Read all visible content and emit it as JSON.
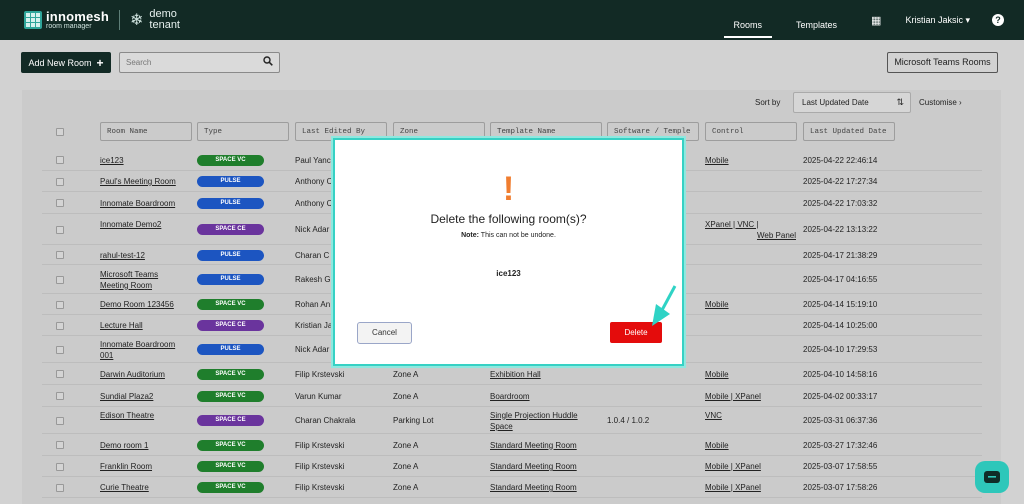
{
  "brand": {
    "name": "innomesh",
    "sub": "room manager",
    "tenant_line1": "demo",
    "tenant_line2": "tenant"
  },
  "nav": {
    "rooms": "Rooms",
    "templates": "Templates",
    "user": "Kristian Jaksic ▾",
    "help": "?"
  },
  "toolbar": {
    "add_label": "Add New Room",
    "add_icon": "+",
    "search_placeholder": "Search",
    "teams_label": "Microsoft Teams Rooms"
  },
  "sort": {
    "label": "Sort by",
    "value": "Last Updated Date",
    "customise": "Customise ›"
  },
  "columns": [
    "Room Name",
    "Type",
    "Last Edited By",
    "Zone",
    "Template Name",
    "Software / Temple",
    "Control",
    "Last Updated Date"
  ],
  "rows": [
    {
      "name": "ice123",
      "name2": "",
      "type": "SPACE VC",
      "edited": "Paul Yanc",
      "zone": "",
      "template": "",
      "template2": "",
      "software": "",
      "control": "Mobile",
      "date": "2025-04-22 22:46:14"
    },
    {
      "name": "Paul's Meeting Room",
      "name2": "",
      "type": "PULSE",
      "edited": "Anthony C",
      "zone": "",
      "template": "",
      "template2": "",
      "software": "",
      "control": "",
      "date": "2025-04-22 17:27:34"
    },
    {
      "name": "Innomate Boardroom",
      "name2": "",
      "type": "PULSE",
      "edited": "Anthony C",
      "zone": "",
      "template": "",
      "template2": "",
      "software": "",
      "control": "",
      "date": "2025-04-22 17:03:32"
    },
    {
      "name": "Innomate Demo2",
      "name2": "",
      "type": "SPACE CE",
      "edited": "Nick Adar",
      "zone": "",
      "template": "",
      "template2": "",
      "software": "",
      "control": "XPanel | VNC |",
      "control2": "Web Panel",
      "date": "2025-04-22 13:13:22"
    },
    {
      "name": "rahul-test-12",
      "name2": "",
      "type": "PULSE",
      "edited": "Charan C",
      "zone": "",
      "template": "",
      "template2": "",
      "software": "",
      "control": "",
      "date": "2025-04-17 21:38:29"
    },
    {
      "name": "Microsoft Teams",
      "name2": "Meeting Room",
      "type": "PULSE",
      "edited": "Rakesh G",
      "zone": "",
      "template": "",
      "template2": "",
      "software": "",
      "control": "",
      "date": "2025-04-17 04:16:55"
    },
    {
      "name": "Demo Room 123456",
      "name2": "",
      "type": "SPACE VC",
      "edited": "Rohan An",
      "zone": "",
      "template": "",
      "template2": "",
      "software": "",
      "control": "Mobile",
      "date": "2025-04-14 15:19:10"
    },
    {
      "name": "Lecture Hall",
      "name2": "",
      "type": "SPACE CE",
      "edited": "Kristian Ja",
      "zone": "",
      "template": "",
      "template2": "",
      "software": "",
      "control": "",
      "date": "2025-04-14 10:25:00"
    },
    {
      "name": "Innomate Boardroom",
      "name2": "001",
      "type": "PULSE",
      "edited": "Nick Adar",
      "zone": "",
      "template": "",
      "template2": "",
      "software": "",
      "control": "",
      "date": "2025-04-10 17:29:53"
    },
    {
      "name": "Darwin Auditorium",
      "name2": "",
      "type": "SPACE VC",
      "edited": "Filip Krstevski",
      "zone": "Zone A",
      "template": "Exhibition Hall",
      "template2": "",
      "software": "",
      "control": "Mobile",
      "date": "2025-04-10 14:58:16"
    },
    {
      "name": "Sundial Plaza2",
      "name2": "",
      "type": "SPACE VC",
      "edited": "Varun Kumar",
      "zone": "Zone A",
      "template": "Boardroom",
      "template2": "",
      "software": "",
      "control": "Mobile | XPanel",
      "date": "2025-04-02 00:33:17"
    },
    {
      "name": "Edison Theatre",
      "name2": "",
      "type": "SPACE CE",
      "edited": "Charan Chakrala",
      "zone": "Parking Lot",
      "template": "Single Projection Huddle",
      "template2": "Space",
      "software": "1.0.4 / 1.0.2",
      "control": "VNC",
      "date": "2025-03-31 06:37:36"
    },
    {
      "name": "Demo room 1",
      "name2": "",
      "type": "SPACE VC",
      "edited": "Filip Krstevski",
      "zone": "Zone A",
      "template": "Standard Meeting Room",
      "template2": "",
      "software": "",
      "control": "Mobile",
      "date": "2025-03-27 17:32:46"
    },
    {
      "name": "Franklin Room",
      "name2": "",
      "type": "SPACE VC",
      "edited": "Filip Krstevski",
      "zone": "Zone A",
      "template": "Standard Meeting Room",
      "template2": "",
      "software": "",
      "control": "Mobile | XPanel",
      "date": "2025-03-07 17:58:55"
    },
    {
      "name": "Curie Theatre",
      "name2": "",
      "type": "SPACE VC",
      "edited": "Filip Krstevski",
      "zone": "Zone A",
      "template": "Standard Meeting Room",
      "template2": "",
      "software": "",
      "control": "Mobile | XPanel",
      "date": "2025-03-07 17:58:26"
    }
  ],
  "modal": {
    "warning_icon": "!",
    "title": "Delete the following room(s)?",
    "note_bold": "Note:",
    "note_text": " This can not be undone.",
    "room": "ice123",
    "cancel": "Cancel",
    "delete": "Delete"
  },
  "colors": {
    "header_bg": "#122a25",
    "accent": "#36d1c4",
    "delete": "#e40c0c",
    "warning": "#f07d2f",
    "badge_vc": "#1f7e2c",
    "badge_pulse": "#1c55c1",
    "badge_ce": "#6a349d"
  },
  "icons": {
    "search": "search-icon",
    "grid": "apps-grid-icon",
    "help": "help-icon",
    "sort": "sort-icon",
    "chat": "chat-icon",
    "pointer": "pointer-arrow-icon"
  }
}
